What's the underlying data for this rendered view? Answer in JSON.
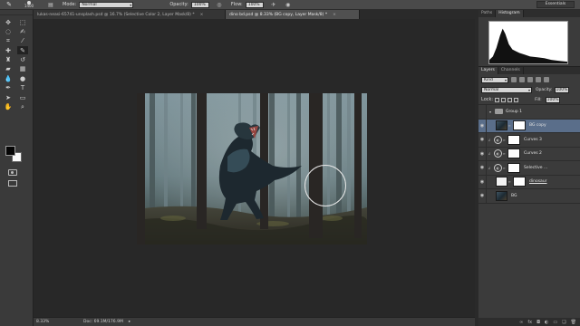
{
  "options_bar": {
    "brush_size": "1400",
    "mode_label": "Mode:",
    "mode_value": "Normal",
    "opacity_label": "Opacity:",
    "opacity_value": "100%",
    "flow_label": "Flow:",
    "flow_value": "100%",
    "workspace": "Essentials"
  },
  "documents": {
    "tabs": [
      {
        "label": "lukas-neasi-65741-unsplash.psd @ 16.7% (Selective Color 2, Layer Mask/8) *",
        "close": "×"
      },
      {
        "label": "dino bd.psd @ 8.33% (BG copy, Layer Mask/8) *",
        "close": "×"
      }
    ]
  },
  "status": {
    "zoom": "8.33%",
    "doc_size": "Doc: 69.1M/176.9M",
    "arrow": "▸"
  },
  "histogram_panel": {
    "tabs": [
      "Paths",
      "Histogram"
    ]
  },
  "layers_panel": {
    "tabs": [
      "Layers",
      "Channels"
    ],
    "kind": "Kind",
    "blend_mode": "Normal",
    "opacity_label": "Opacity:",
    "opacity_value": "100%",
    "lock_label": "Lock:",
    "fill_label": "Fill:",
    "fill_value": "100%",
    "layers": [
      {
        "name": "Group 1"
      },
      {
        "name": "BG copy"
      },
      {
        "name": "Curves 3"
      },
      {
        "name": "Curves 2"
      },
      {
        "name": "Selective ..."
      },
      {
        "name": "dinosaur"
      },
      {
        "name": "BG"
      }
    ],
    "bottom_icons": [
      "link-icon",
      "fx-icon",
      "mask-icon",
      "adjustment-icon",
      "folder-icon",
      "new-layer-icon",
      "trash-icon"
    ]
  },
  "colors": {
    "foreground": "#050505",
    "background": "#fafafa",
    "selected_layer": "#5a6e8a"
  }
}
